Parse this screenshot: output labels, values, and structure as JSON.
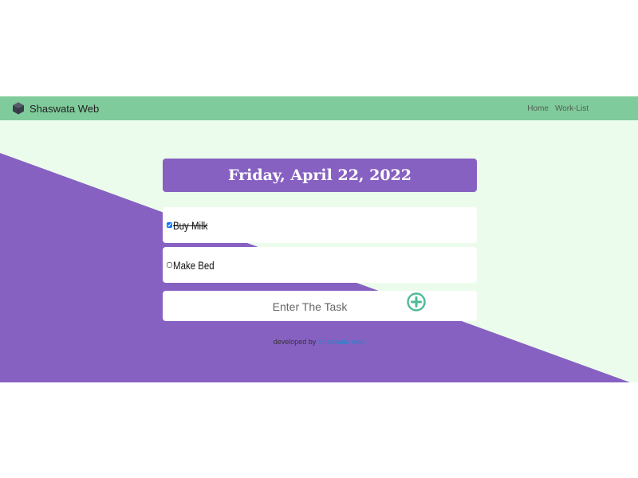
{
  "nav": {
    "brand": "Shaswata Web",
    "links": [
      "Home",
      "Work-List"
    ]
  },
  "date_title": "Friday, April 22, 2022",
  "tasks": [
    {
      "label": "Buy Milk",
      "checked": true
    },
    {
      "label": "Make Bed",
      "checked": false
    }
  ],
  "new_task": {
    "placeholder": "Enter The Task",
    "value": ""
  },
  "footer": {
    "prefix": "developed by",
    "link": "Shaswata web"
  },
  "colors": {
    "navbar": "#80cb9b",
    "purple": "#8761c2",
    "mint_bg": "#ecfcec",
    "add_icon": "#4dbb94",
    "link": "#1f88c9"
  },
  "icons": {
    "brand": "cube-icon",
    "add": "plus-circle-icon"
  }
}
